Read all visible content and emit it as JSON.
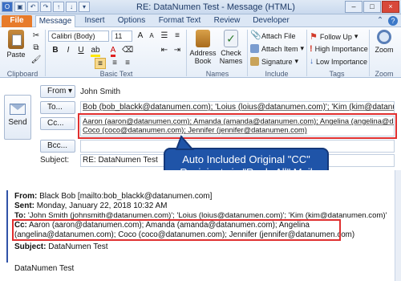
{
  "window": {
    "title": "RE: DataNumen Test  -  Message (HTML)",
    "controls": [
      "–",
      "□",
      "×"
    ]
  },
  "tabs": [
    "File",
    "Message",
    "Insert",
    "Options",
    "Format Text",
    "Review",
    "Developer"
  ],
  "ribbon": {
    "clipboard": {
      "paste": "Paste",
      "label": "Clipboard"
    },
    "basic_text": {
      "font": "Calibri (Body)",
      "size": "11",
      "bold": "B",
      "italic": "I",
      "underline": "U",
      "label": "Basic Text"
    },
    "names": {
      "address_book": "Address Book",
      "check_names": "Check Names",
      "label": "Names"
    },
    "include": {
      "attach_file": "Attach File",
      "attach_item": "Attach Item",
      "signature": "Signature",
      "label": "Include"
    },
    "tags": {
      "follow_up": "Follow Up",
      "high_importance": "High Importance",
      "low_importance": "Low Importance",
      "label": "Tags"
    },
    "zoom": {
      "zoom": "Zoom",
      "label": "Zoom"
    }
  },
  "header": {
    "send_label": "Send",
    "from_button": "From",
    "from_value": "John Smith",
    "to_button": "To...",
    "to_value": "Bob (bob_blackk@datanumen.com); 'Loius (loius@datanumen.com)'; 'Kim (kim@datanumen.com)';",
    "cc_button": "Cc...",
    "cc_line1": "Aaron (aaron@datanumen.com); Amanda (amanda@datanumen.com); Angelina (angelina@datanumen.com);",
    "cc_line2": "Coco (coco@datanumen.com); Jennifer (jennifer@datanumen.com)",
    "bcc_button": "Bcc...",
    "subject_label": "Subject:",
    "subject_value": "RE: DataNumen Test"
  },
  "callout": {
    "line1": "Auto Included Original \"CC\"",
    "line2": "Recipients in \"Reply All\" Mail"
  },
  "body": {
    "from_label": "From:",
    "from_value": " Black Bob [mailto:bob_blackk@datanumen.com]",
    "sent_label": "Sent:",
    "sent_value": " Monday, January 22, 2018 10:32 AM",
    "to_label": "To:",
    "to_value": " 'John Smith (johnsmith@datanumen.com)'; 'Loius (loius@datanumen.com)'; 'Kim (kim@datanumen.com)'",
    "cc_label": "Cc:",
    "cc_line1": " Aaron (aaron@datanumen.com); Amanda (amanda@datanumen.com); Angelina",
    "cc_line2": "(angelina@datanumen.com); Coco (coco@datanumen.com); Jennifer (jennifer@datanumen.com)",
    "subject_label": "Subject:",
    "subject_value": " DataNumen Test",
    "text": "DataNumen Test"
  },
  "colors": {
    "accent_red": "#e03030",
    "callout_blue": "#1f54a8",
    "file_tab": "#e77b2a"
  }
}
